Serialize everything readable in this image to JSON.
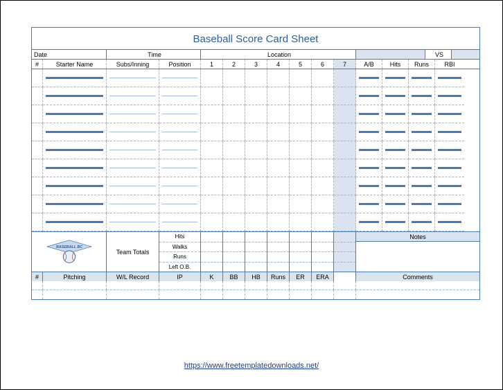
{
  "title": "Baseball Score Card Sheet",
  "meta": {
    "date_label": "Date",
    "time_label": "Time",
    "location_label": "Location",
    "vs_label": "VS"
  },
  "cols": {
    "num": "#",
    "starter": "Starter Name",
    "subs": "Subs/Inning",
    "position": "Position",
    "innings": [
      "1",
      "2",
      "3",
      "4",
      "5",
      "6",
      "7"
    ],
    "ab": "A/B",
    "hits": "Hits",
    "runs": "Runs",
    "rbi": "RBI"
  },
  "totals": {
    "team_totals": "Team Totals",
    "stat_rows": [
      "Hits",
      "Walks",
      "Runs",
      "Left O.B."
    ],
    "notes": "Notes"
  },
  "pitching": {
    "num": "#",
    "pitching": "Pitching",
    "wl": "W/L Record",
    "ip": "IP",
    "stats": [
      "K",
      "BB",
      "HB",
      "Runs",
      "ER",
      "ERA"
    ],
    "comments": "Comments"
  },
  "logo": {
    "text": "BASEBALL BC"
  },
  "link": {
    "url": "https://www.freetemplatedownloads.net/",
    "text": "https://www.freetemplatedownloads.net/"
  }
}
